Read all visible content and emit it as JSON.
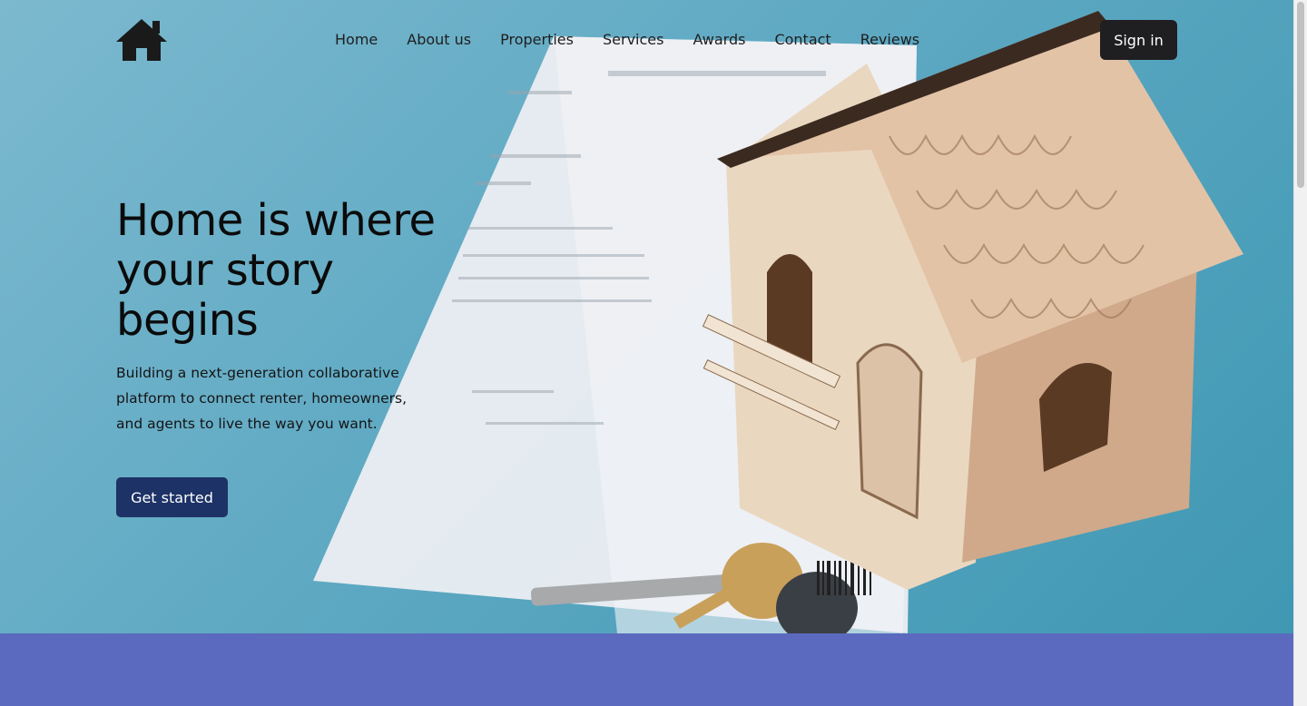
{
  "nav": {
    "items": [
      "Home",
      "About us",
      "Properties",
      "Services",
      "Awards",
      "Contact",
      "Reviews"
    ],
    "signin_label": "Sign in",
    "logo_icon": "house-icon"
  },
  "hero": {
    "title": "Home is where your story begins",
    "subtitle": "Building a next-generation collaborative platform to connect renter, homeowners, and agents to live the way you want.",
    "cta_label": "Get started",
    "background_image": "wooden-house-model-with-keys-photo"
  },
  "colors": {
    "hero_bg": "#5fa9c3",
    "signin_bg": "#1f1f21",
    "cta_bg": "#1d3266",
    "section_bg": "#5b6abf",
    "text_dark": "#0b0b0b"
  }
}
